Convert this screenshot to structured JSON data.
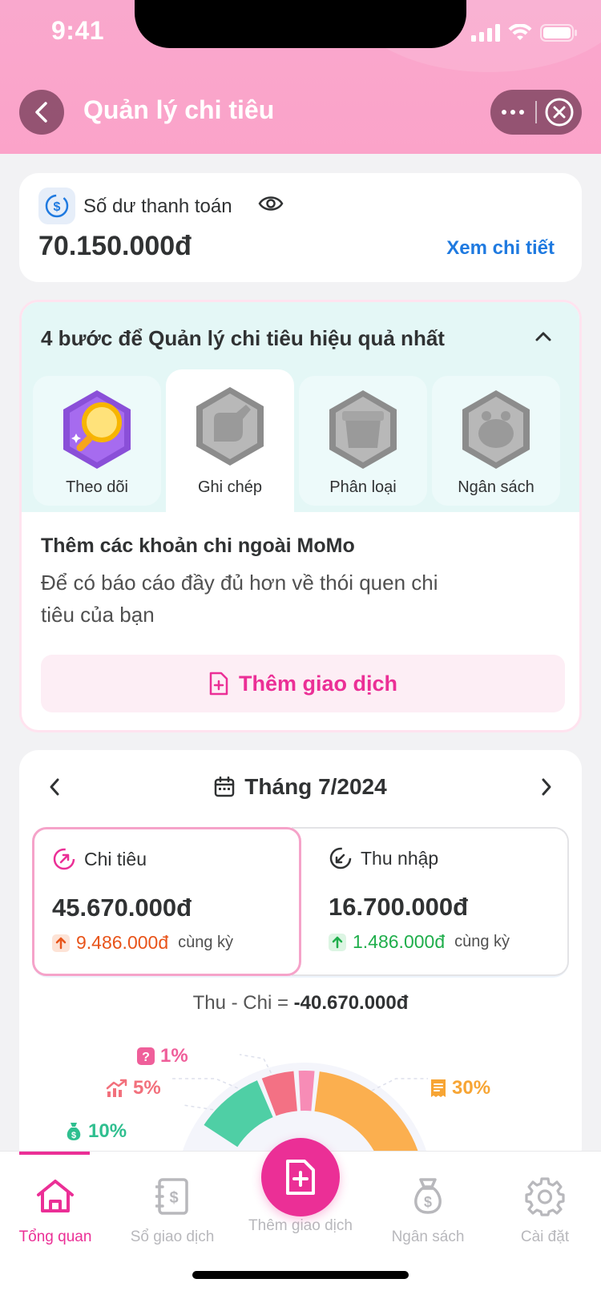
{
  "status_bar": {
    "time": "9:41"
  },
  "header": {
    "title": "Quản lý chi tiêu"
  },
  "balance": {
    "label": "Số dư thanh toán",
    "amount": "70.150.000đ",
    "detail_link": "Xem chi tiết"
  },
  "steps": {
    "title": "4 bước để Quản lý chi tiêu hiệu quả nhất",
    "items": [
      {
        "label": "Theo dõi",
        "state": "done"
      },
      {
        "label": "Ghi chép",
        "state": "current"
      },
      {
        "label": "Phân loại",
        "state": "locked"
      },
      {
        "label": "Ngân sách",
        "state": "locked"
      }
    ],
    "heading": "Thêm các khoản chi ngoài MoMo",
    "description": "Để có báo cáo đầy đủ hơn về thói quen chi tiêu của bạn",
    "add_button": "Thêm giao dịch"
  },
  "month_summary": {
    "month": "Tháng 7/2024",
    "expense": {
      "label": "Chi tiêu",
      "amount": "45.670.000đ",
      "change": "9.486.000đ",
      "change_suffix": "cùng kỳ",
      "trend": "up"
    },
    "income": {
      "label": "Thu nhập",
      "amount": "16.700.000đ",
      "change": "1.486.000đ",
      "change_suffix": "cùng kỳ",
      "trend": "up"
    },
    "diff_label": "Thu - Chi =",
    "diff_value": "-40.670.000đ"
  },
  "category_breakdown": {
    "labels": [
      {
        "text": "1%",
        "icon": "question-icon",
        "color": "#ef5f9a"
      },
      {
        "text": "5%",
        "icon": "chart-up-icon",
        "color": "#f2707c"
      },
      {
        "text": "10%",
        "icon": "money-bag-icon",
        "color": "#2fbf8f"
      },
      {
        "text": "30%",
        "icon": "receipt-icon",
        "color": "#f7a534"
      }
    ],
    "segments": [
      {
        "percent": 10,
        "color": "#4fcfa5"
      },
      {
        "percent": 5,
        "color": "#f37184"
      },
      {
        "percent": 1,
        "color": "#f78cb6"
      },
      {
        "percent": 30,
        "color": "#fbaf4f"
      }
    ]
  },
  "tabbar": {
    "tabs": [
      {
        "label": "Tổng quan",
        "icon": "home-icon"
      },
      {
        "label": "Sổ giao dịch",
        "icon": "ledger-icon"
      },
      {
        "label": "Thêm giao dịch",
        "icon": "add-document-icon"
      },
      {
        "label": "Ngân sách",
        "icon": "money-bag-icon"
      },
      {
        "label": "Cài đặt",
        "icon": "gear-icon"
      }
    ]
  },
  "colors": {
    "accent": "#eb2f96",
    "link": "#1f7ae0",
    "header": "#f9a8cd",
    "expense_trend": "#e8541a",
    "income_trend": "#1fae4b"
  }
}
